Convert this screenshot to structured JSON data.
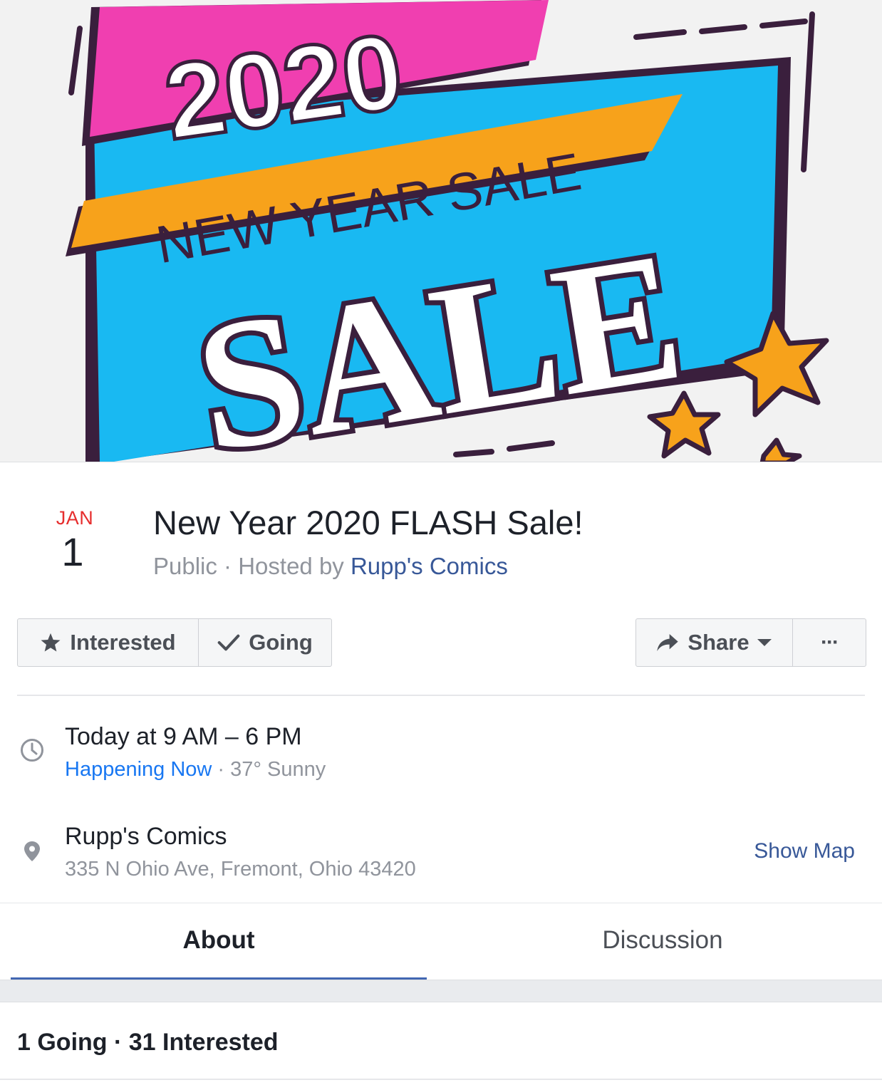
{
  "cover": {
    "year_text": "2020",
    "banner_text": "NEW YEAR SALE",
    "sale_text": "SALE",
    "colors": {
      "pink": "#f03fb0",
      "blue": "#19b9f2",
      "orange": "#f7a21b",
      "dark": "#3a1f3d",
      "background": "#f2f2f2"
    }
  },
  "event": {
    "month": "JAN",
    "day": "1",
    "title": "New Year 2020 FLASH Sale!",
    "privacy": "Public",
    "separator": " · ",
    "hosted_by_prefix": "Hosted by ",
    "host": "Rupp's Comics"
  },
  "actions": {
    "interested_label": "Interested",
    "going_label": "Going",
    "share_label": "Share",
    "more_label": "···"
  },
  "time": {
    "main": "Today at 9 AM – 6 PM",
    "status": "Happening Now",
    "separator": " · ",
    "weather": "37° Sunny"
  },
  "location": {
    "name": "Rupp's Comics",
    "address": "335 N Ohio Ave, Fremont, Ohio 43420",
    "map_link": "Show Map"
  },
  "tabs": [
    {
      "label": "About",
      "active": true
    },
    {
      "label": "Discussion",
      "active": false
    }
  ],
  "stats": {
    "text": "1 Going · 31 Interested"
  },
  "icons": [
    "star-icon",
    "check-icon",
    "share-arrow-icon",
    "caret-down-icon",
    "clock-icon",
    "map-pin-icon"
  ],
  "colors": {
    "accent": "#4267b2",
    "link": "#385898",
    "happening_now": "#1877f2",
    "month_red": "#e62e2e"
  }
}
